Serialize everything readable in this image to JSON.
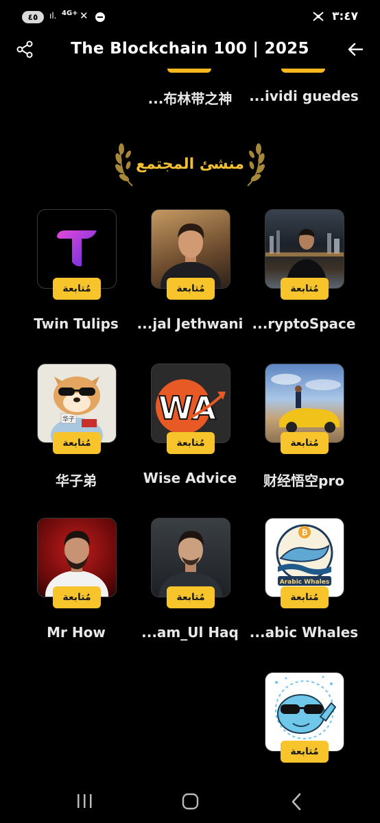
{
  "status_bar": {
    "battery": "٤٥",
    "network": "4G+",
    "time": "٣:٤٧"
  },
  "header": {
    "title": "The Blockchain 100 | 2025",
    "share_icon": "share-icon",
    "back_icon": "arrow-left-icon"
  },
  "top_row": {
    "names": [
      "...ividi guedes",
      "...布林带之神"
    ]
  },
  "section": {
    "title": "منشئ المجتمع"
  },
  "follow_label": "مُتابعة",
  "creators": [
    {
      "name": "Twin Tulips"
    },
    {
      "name": "...jal Jethwani"
    },
    {
      "name": "...ryptoSpace"
    },
    {
      "name": "华子弟"
    },
    {
      "name": "Wise Advice"
    },
    {
      "name": "财经悟空pro"
    },
    {
      "name": "Mr How"
    },
    {
      "name": "...am_Ul Haq"
    },
    {
      "name": "...abic Whales"
    },
    {
      "name": ""
    }
  ],
  "logo_text": {
    "wise_advice": "WA",
    "arabic_whales": "Arabic Whales",
    "huazi_sign": "华子"
  },
  "colors": {
    "accent_gold": "#f7c52b",
    "background": "#000000"
  }
}
